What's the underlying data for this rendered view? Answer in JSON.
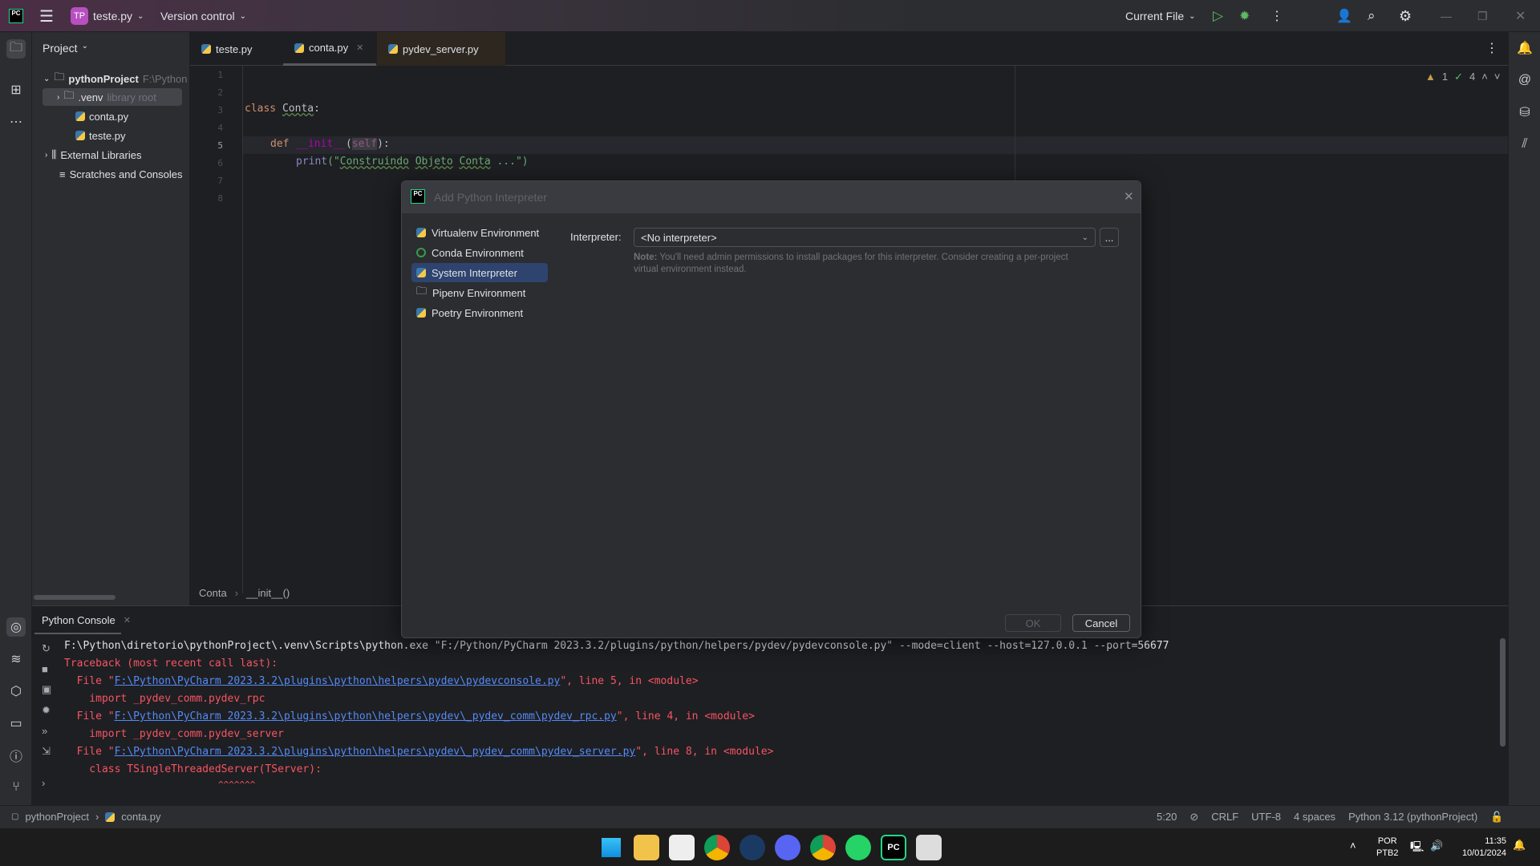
{
  "titlebar": {
    "project_badge": "TP",
    "project": "teste.py",
    "vcs": "Version control",
    "run_config": "Current File"
  },
  "project_panel": {
    "title": "Project",
    "items": [
      {
        "label": "pythonProject",
        "hint": "F:\\Python"
      },
      {
        "label": ".venv",
        "hint": "library root"
      },
      {
        "label": "conta.py"
      },
      {
        "label": "teste.py"
      },
      {
        "label": "External Libraries"
      },
      {
        "label": "Scratches and Consoles"
      }
    ]
  },
  "tabs": [
    {
      "label": "teste.py"
    },
    {
      "label": "conta.py",
      "active": true
    },
    {
      "label": "pydev_server.py"
    }
  ],
  "editor": {
    "line_numbers": [
      "1",
      "2",
      "3",
      "4",
      "5",
      "6",
      "7",
      "8"
    ],
    "code": {
      "class_kw": "class",
      "class_name": "Conta",
      "colon": ":",
      "def_kw": "def",
      "init": "__init__",
      "lp": "(",
      "self": "self",
      "rp": "):",
      "print": "print",
      "str_open": "(\"",
      "s1": "Construindo",
      "s2": "Objeto",
      "s3": "Conta",
      "s4": " ...\")"
    },
    "inspections": {
      "warnings": "1",
      "ok": "4"
    },
    "breadcrumb": [
      "Conta",
      "__init__()"
    ]
  },
  "dialog": {
    "title": "Add Python Interpreter",
    "envs": [
      {
        "label": "Virtualenv Environment"
      },
      {
        "label": "Conda Environment"
      },
      {
        "label": "System Interpreter",
        "selected": true
      },
      {
        "label": "Pipenv Environment"
      },
      {
        "label": "Poetry Environment"
      }
    ],
    "interpreter_label": "Interpreter:",
    "interpreter_value": "<No interpreter>",
    "browse": "...",
    "note_bold": "Note:",
    "note": " You'll need admin permissions to install packages for this interpreter. Consider creating a per-project",
    "note2": "virtual environment instead.",
    "ok": "OK",
    "cancel": "Cancel"
  },
  "console": {
    "tab": "Python Console",
    "lines": {
      "cmd": "F:\\Python\\diretorio\\pythonProject\\.venv\\Scripts\\python.exe \"F:/Python/PyCharm 2023.3.2/plugins/python/helpers/pydev/pydevconsole.py\" --mode=client --host=127.0.0.1 --port=56677",
      "tb": "Traceback (most recent call last):",
      "f1a": "  File \"",
      "f1link": "F:\\Python\\PyCharm 2023.3.2\\plugins\\python\\helpers\\pydev\\pydevconsole.py",
      "f1b": "\", line 5, in <module>",
      "i1": "    import _pydev_comm.pydev_rpc",
      "f2a": "  File \"",
      "f2link": "F:\\Python\\PyCharm 2023.3.2\\plugins\\python\\helpers\\pydev\\_pydev_comm\\pydev_rpc.py",
      "f2b": "\", line 4, in <module>",
      "i2": "    import _pydev_comm.pydev_server",
      "f3a": "  File \"",
      "f3link": "F:\\Python\\PyCharm 2023.3.2\\plugins\\python\\helpers\\pydev\\_pydev_comm\\pydev_server.py",
      "f3b": "\", line 8, in <module>",
      "c1": "    class TSingleThreadedServer(TServer):",
      "caret": "                             ^^^^^^^"
    }
  },
  "statusbar": {
    "project": "pythonProject",
    "file": "conta.py",
    "position": "5:20",
    "line_sep": "CRLF",
    "encoding": "UTF-8",
    "indent": "4 spaces",
    "interpreter": "Python 3.12 (pythonProject)"
  },
  "taskbar": {
    "lang1": "POR",
    "lang2": "PTB2",
    "time": "11:35",
    "date": "10/01/2024"
  },
  "colors": {
    "accent": "#2e436e",
    "error": "#f75464",
    "link": "#548af7",
    "run": "#5fb865"
  }
}
